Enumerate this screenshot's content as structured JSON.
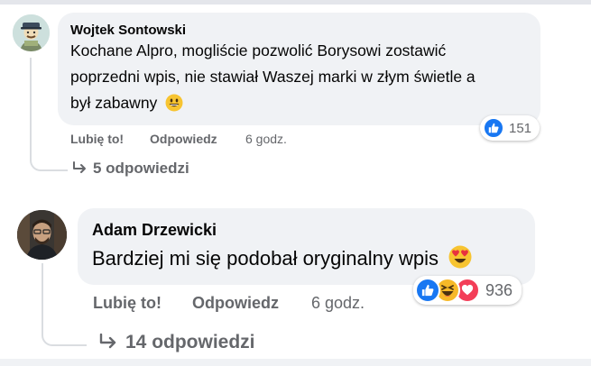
{
  "comments": [
    {
      "author": "Wojtek Sontowski",
      "lines": [
        "Kochane Alpro, mogliście pozwolić Borysowi zostawić",
        "poprzedni wpis, nie stawiał Waszej marki w złym świetle a",
        "był zabawny"
      ],
      "like_label": "Lubię to!",
      "reply_label": "Odpowiedz",
      "time": "6 godz.",
      "reaction_count": "151",
      "replies_label": "5 odpowiedzi"
    },
    {
      "author": "Adam Drzewicki",
      "lines": [
        "Bardziej mi się podobał oryginalny wpis"
      ],
      "like_label": "Lubię to!",
      "reply_label": "Odpowiedz",
      "time": "6 godz.",
      "reaction_count": "936",
      "replies_label": "14 odpowiedzi"
    }
  ],
  "reaction_icons": [
    "like-icon",
    "haha-icon",
    "love-icon"
  ],
  "colors": {
    "like": "#1877f2",
    "love": "#f33e58",
    "haha": "#f7b928",
    "bubble": "#f0f2f5",
    "meta": "#65676b"
  }
}
